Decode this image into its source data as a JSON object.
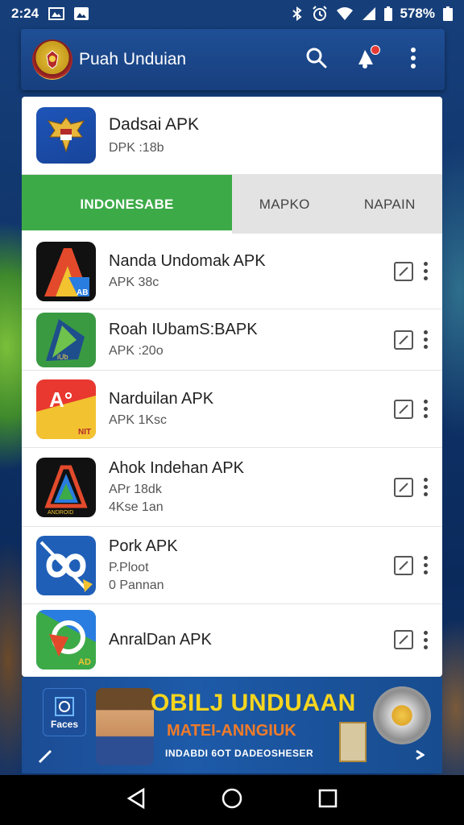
{
  "status_bar": {
    "time": "2:24",
    "battery": "578%",
    "icons": [
      "gallery-icon",
      "image-icon",
      "bluetooth-icon",
      "alarm-icon",
      "wifi-icon",
      "signal-icon",
      "battery-icon"
    ]
  },
  "header": {
    "title": "Puah Unduian",
    "icons": [
      "search-icon",
      "notification-icon",
      "more-vert-icon"
    ]
  },
  "featured": {
    "title": "Dadsai APK",
    "subtitle": "DPK :18b"
  },
  "tabs": [
    {
      "label": "INDONESABE",
      "active": true
    },
    {
      "label": "MAPKO",
      "active": false
    },
    {
      "label": "NAPAIN",
      "active": false
    }
  ],
  "apps": [
    {
      "title": "Nanda Undomak APK",
      "line1": "APK 38c",
      "line2": ""
    },
    {
      "title": "Roah IUbamS:BAPK",
      "line1": "APK :20o",
      "line2": ""
    },
    {
      "title": "Narduilan APK",
      "line1": "APK 1Ksc",
      "line2": ""
    },
    {
      "title": "Ahok Indehan APK",
      "line1": "APr 18dk",
      "line2": "4Kse 1an"
    },
    {
      "title": "Pork APK",
      "line1": "P.Ploot",
      "line2": "0 Pannan"
    },
    {
      "title": "AnralDan APK",
      "line1": "",
      "line2": ""
    }
  ],
  "banner": {
    "app_label": "Faces",
    "headline": "OBILJ UNDUAAN",
    "subline": "MATEI-ANNGIUK",
    "small": "INDABDI 6OT DADEOSHESER"
  },
  "colors": {
    "header_bg": "#1f4f96",
    "tab_active": "#3daa48",
    "tab_inactive": "#e3e3e3",
    "banner_headline": "#f6d51f",
    "banner_sub": "#f07b2a"
  }
}
